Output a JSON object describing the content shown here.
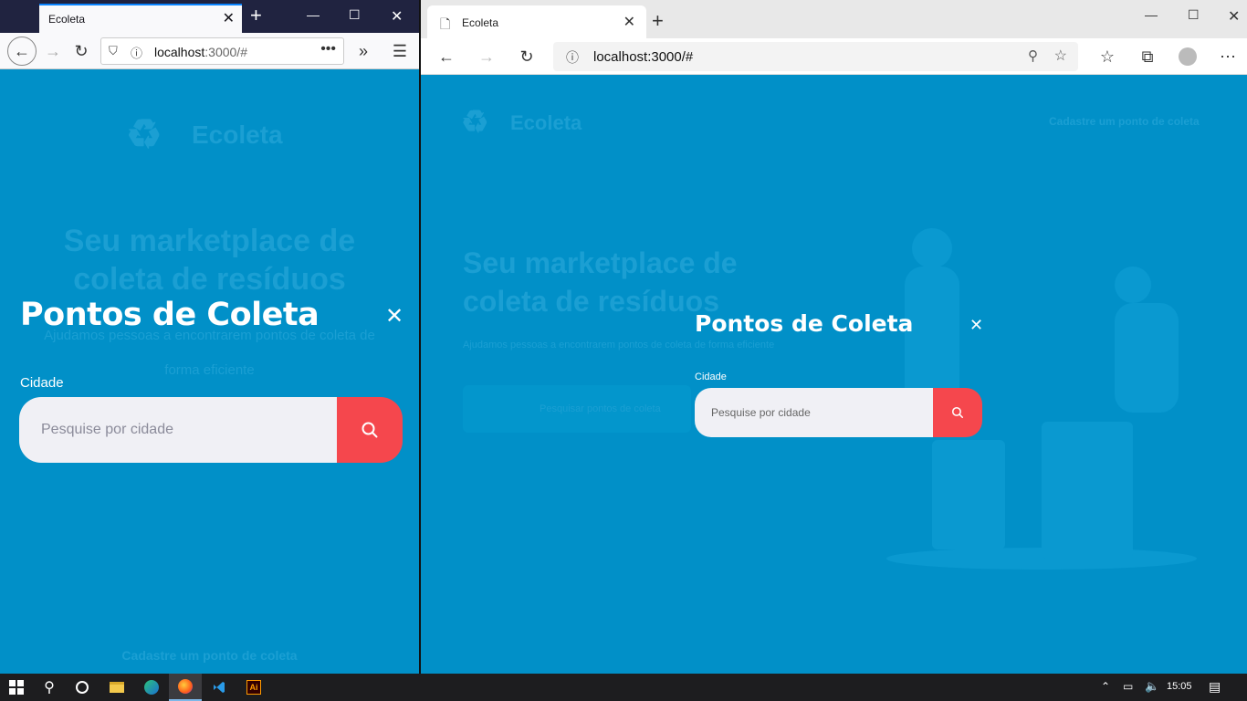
{
  "firefox": {
    "tab_title": "Ecoleta",
    "url_host": "localhost",
    "url_rest": ":3000/#",
    "bg_logo": "Ecoleta",
    "bg_heading_1": "Seu marketplace de",
    "bg_heading_2": "coleta de resíduos",
    "bg_sub_1": "Ajudamos pessoas a encontrarem pontos de coleta de",
    "bg_sub_2": "forma eficiente",
    "bg_footer_link": "Cadastre um ponto de coleta",
    "modal": {
      "title": "Pontos de Coleta",
      "label": "Cidade",
      "placeholder": "Pesquise por cidade"
    }
  },
  "edge": {
    "tab_title": "Ecoleta",
    "url": "localhost:3000/#",
    "bg_logo": "Ecoleta",
    "bg_header_link": "Cadastre um ponto de coleta",
    "bg_heading_1": "Seu marketplace de",
    "bg_heading_2": "coleta de resíduos",
    "bg_sub": "Ajudamos pessoas a encontrarem pontos de coleta de forma eficiente",
    "bg_search_placeholder": "Pesquisar pontos de coleta",
    "modal": {
      "title": "Pontos de Coleta",
      "label": "Cidade",
      "placeholder": "Pesquise por cidade"
    }
  },
  "taskbar": {
    "time": "15:05",
    "apps": [
      "windows-start",
      "search",
      "cortana",
      "file-explorer",
      "edge",
      "firefox",
      "vscode",
      "illustrator"
    ]
  },
  "colors": {
    "page_bg": "#0190c8",
    "accent_red": "#f5474d",
    "input_bg": "#f0f0f5"
  }
}
